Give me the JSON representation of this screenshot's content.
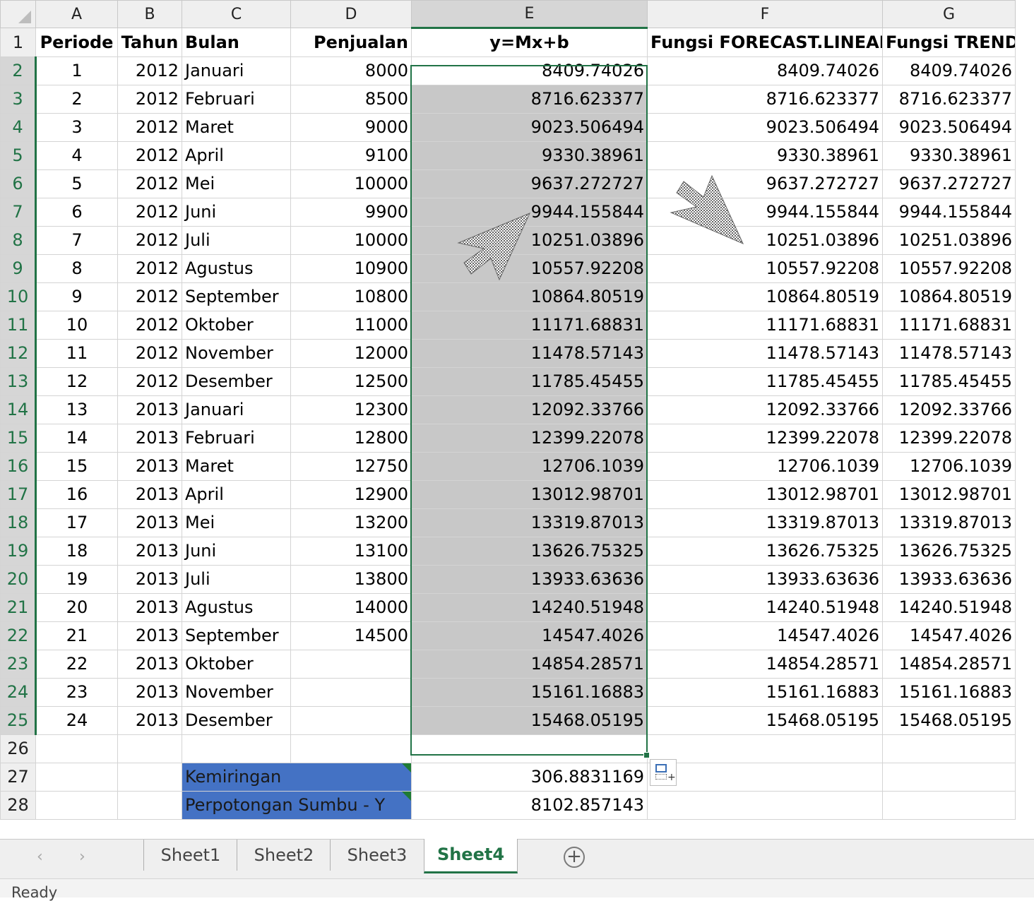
{
  "columns": [
    "A",
    "B",
    "C",
    "D",
    "E",
    "F",
    "G"
  ],
  "headers": [
    "Periode",
    "Tahun",
    "Bulan",
    "Penjualan",
    "y=Mx+b",
    "Fungsi FORECAST.LINEAR",
    "Fungsi TREND"
  ],
  "rows": [
    {
      "n": "2",
      "periode": "1",
      "tahun": "2012",
      "bulan": "Januari",
      "penjualan": "8000",
      "e": "8409.74026",
      "f": "8409.74026",
      "g": "8409.74026"
    },
    {
      "n": "3",
      "periode": "2",
      "tahun": "2012",
      "bulan": "Februari",
      "penjualan": "8500",
      "e": "8716.623377",
      "f": "8716.623377",
      "g": "8716.623377"
    },
    {
      "n": "4",
      "periode": "3",
      "tahun": "2012",
      "bulan": "Maret",
      "penjualan": "9000",
      "e": "9023.506494",
      "f": "9023.506494",
      "g": "9023.506494"
    },
    {
      "n": "5",
      "periode": "4",
      "tahun": "2012",
      "bulan": "April",
      "penjualan": "9100",
      "e": "9330.38961",
      "f": "9330.38961",
      "g": "9330.38961"
    },
    {
      "n": "6",
      "periode": "5",
      "tahun": "2012",
      "bulan": "Mei",
      "penjualan": "10000",
      "e": "9637.272727",
      "f": "9637.272727",
      "g": "9637.272727"
    },
    {
      "n": "7",
      "periode": "6",
      "tahun": "2012",
      "bulan": "Juni",
      "penjualan": "9900",
      "e": "9944.155844",
      "f": "9944.155844",
      "g": "9944.155844"
    },
    {
      "n": "8",
      "periode": "7",
      "tahun": "2012",
      "bulan": "Juli",
      "penjualan": "10000",
      "e": "10251.03896",
      "f": "10251.03896",
      "g": "10251.03896"
    },
    {
      "n": "9",
      "periode": "8",
      "tahun": "2012",
      "bulan": "Agustus",
      "penjualan": "10900",
      "e": "10557.92208",
      "f": "10557.92208",
      "g": "10557.92208"
    },
    {
      "n": "10",
      "periode": "9",
      "tahun": "2012",
      "bulan": "September",
      "penjualan": "10800",
      "e": "10864.80519",
      "f": "10864.80519",
      "g": "10864.80519"
    },
    {
      "n": "11",
      "periode": "10",
      "tahun": "2012",
      "bulan": "Oktober",
      "penjualan": "11000",
      "e": "11171.68831",
      "f": "11171.68831",
      "g": "11171.68831"
    },
    {
      "n": "12",
      "periode": "11",
      "tahun": "2012",
      "bulan": "November",
      "penjualan": "12000",
      "e": "11478.57143",
      "f": "11478.57143",
      "g": "11478.57143"
    },
    {
      "n": "13",
      "periode": "12",
      "tahun": "2012",
      "bulan": "Desember",
      "penjualan": "12500",
      "e": "11785.45455",
      "f": "11785.45455",
      "g": "11785.45455"
    },
    {
      "n": "14",
      "periode": "13",
      "tahun": "2013",
      "bulan": "Januari",
      "penjualan": "12300",
      "e": "12092.33766",
      "f": "12092.33766",
      "g": "12092.33766"
    },
    {
      "n": "15",
      "periode": "14",
      "tahun": "2013",
      "bulan": "Februari",
      "penjualan": "12800",
      "e": "12399.22078",
      "f": "12399.22078",
      "g": "12399.22078"
    },
    {
      "n": "16",
      "periode": "15",
      "tahun": "2013",
      "bulan": "Maret",
      "penjualan": "12750",
      "e": "12706.1039",
      "f": "12706.1039",
      "g": "12706.1039"
    },
    {
      "n": "17",
      "periode": "16",
      "tahun": "2013",
      "bulan": "April",
      "penjualan": "12900",
      "e": "13012.98701",
      "f": "13012.98701",
      "g": "13012.98701"
    },
    {
      "n": "18",
      "periode": "17",
      "tahun": "2013",
      "bulan": "Mei",
      "penjualan": "13200",
      "e": "13319.87013",
      "f": "13319.87013",
      "g": "13319.87013"
    },
    {
      "n": "19",
      "periode": "18",
      "tahun": "2013",
      "bulan": "Juni",
      "penjualan": "13100",
      "e": "13626.75325",
      "f": "13626.75325",
      "g": "13626.75325"
    },
    {
      "n": "20",
      "periode": "19",
      "tahun": "2013",
      "bulan": "Juli",
      "penjualan": "13800",
      "e": "13933.63636",
      "f": "13933.63636",
      "g": "13933.63636"
    },
    {
      "n": "21",
      "periode": "20",
      "tahun": "2013",
      "bulan": "Agustus",
      "penjualan": "14000",
      "e": "14240.51948",
      "f": "14240.51948",
      "g": "14240.51948"
    },
    {
      "n": "22",
      "periode": "21",
      "tahun": "2013",
      "bulan": "September",
      "penjualan": "14500",
      "e": "14547.4026",
      "f": "14547.4026",
      "g": "14547.4026"
    },
    {
      "n": "23",
      "periode": "22",
      "tahun": "2013",
      "bulan": "Oktober",
      "penjualan": "",
      "e": "14854.28571",
      "f": "14854.28571",
      "g": "14854.28571"
    },
    {
      "n": "24",
      "periode": "23",
      "tahun": "2013",
      "bulan": "November",
      "penjualan": "",
      "e": "15161.16883",
      "f": "15161.16883",
      "g": "15161.16883"
    },
    {
      "n": "25",
      "periode": "24",
      "tahun": "2013",
      "bulan": "Desember",
      "penjualan": "",
      "e": "15468.05195",
      "f": "15468.05195",
      "g": "15468.05195"
    }
  ],
  "summary": [
    {
      "n": "27",
      "label": "Kemiringan",
      "value": "306.8831169"
    },
    {
      "n": "28",
      "label": "Perpotongan Sumbu - Y",
      "value": "8102.857143"
    }
  ],
  "sheets": [
    "Sheet1",
    "Sheet2",
    "Sheet3",
    "Sheet4"
  ],
  "active_sheet": "Sheet4",
  "status": "Ready",
  "icons": {
    "add_sheet": "plus-circle-icon",
    "quick_analysis": "quick-analysis-icon",
    "nav": "chevron-icon"
  },
  "colors": {
    "accent": "#217346",
    "highlight_fill": "#c8c8c8",
    "label_fill": "#4472c4"
  }
}
